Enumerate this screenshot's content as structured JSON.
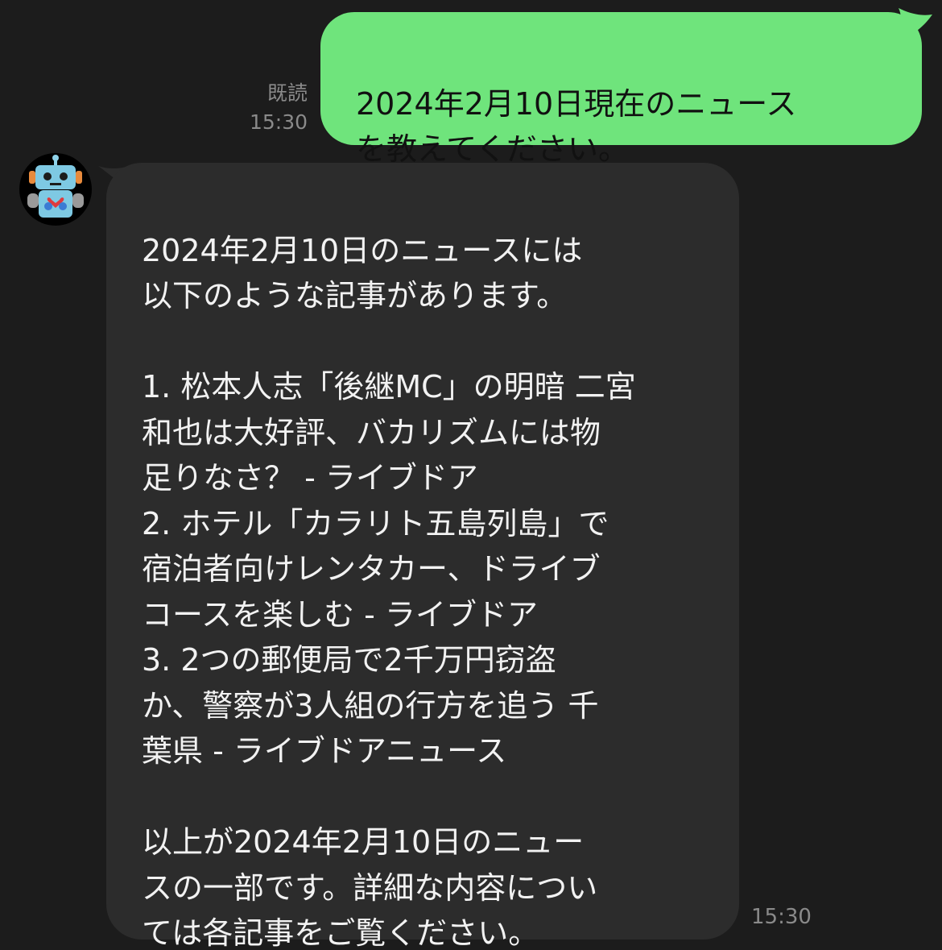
{
  "outgoing_message": {
    "text": "2024年2月10日現在のニュース\nを教えてください。",
    "read_status": "既読",
    "time": "15:30",
    "bubble_color": "#6fe47c"
  },
  "incoming_message": {
    "text": "2024年2月10日のニュースには\n以下のような記事があります。\n\n1. 松本人志「後継MC」の明暗 二宮\n和也は大好評、バカリズムには物\n足りなさ？ - ライブドア\n2. ホテル「カラリト五島列島」で\n宿泊者向けレンタカー、ドライブ\nコースを楽しむ - ライブドア\n3. 2つの郵便局で2千万円窃盗\nか、警察が3人組の行方を追う 千\n葉県 - ライブドアニュース\n\n以上が2024年2月10日のニュー\nスの一部です。詳細な内容につい\nては各記事をご覧ください。",
    "time": "15:30",
    "bubble_color": "#2c2c2c",
    "avatar_icon": "robot-icon"
  },
  "background_color": "#1c1c1c"
}
